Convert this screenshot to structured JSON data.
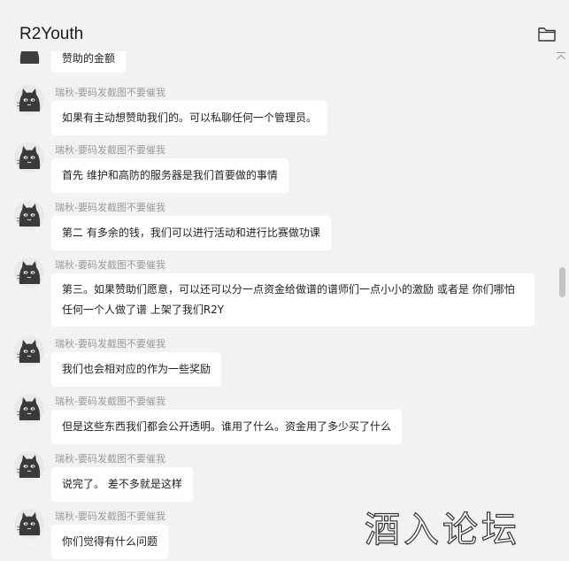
{
  "window": {
    "title": "R2Youth"
  },
  "icons": {
    "folder": "folder-icon",
    "collapse": "chevron-up-icon",
    "avatar": "cat-avatar-icon"
  },
  "partial_message": {
    "text": "赞助的金额"
  },
  "messages": [
    {
      "sender": "瑞秋-要码发截图不要催我",
      "text": "如果有主动想赞助我们的。可以私聊任何一个管理员。"
    },
    {
      "sender": "瑞秋-要码发截图不要催我",
      "text": "首先 维护和高防的服务器是我们首要做的事情"
    },
    {
      "sender": "瑞秋-要码发截图不要催我",
      "text": "第二 有多余的钱，我们可以进行活动和进行比赛做功课"
    },
    {
      "sender": "瑞秋-要码发截图不要催我",
      "text": "第三。如果赞助们愿意，可以还可以分一点资金给做谱的谱师们一点小小的激励   或者是 你们哪怕任何一个人做了谱 上架了我们R2Y"
    },
    {
      "sender": "瑞秋-要码发截图不要催我",
      "text": "我们也会相对应的作为一些奖励"
    },
    {
      "sender": "瑞秋-要码发截图不要催我",
      "text": "但是这些东西我们都会公开透明。谁用了什么。资金用了多少买了什么"
    },
    {
      "sender": "瑞秋-要码发截图不要催我",
      "text": "说完了。 差不多就是这样"
    },
    {
      "sender": "瑞秋-要码发截图不要催我",
      "text": "你们觉得有什么问题"
    }
  ],
  "watermark": {
    "text": "酒入论坛"
  },
  "colors": {
    "background": "#f2f2f2",
    "bubble": "#ffffff",
    "sender_text": "#9a9a9a",
    "message_text": "#1f1f1f"
  }
}
